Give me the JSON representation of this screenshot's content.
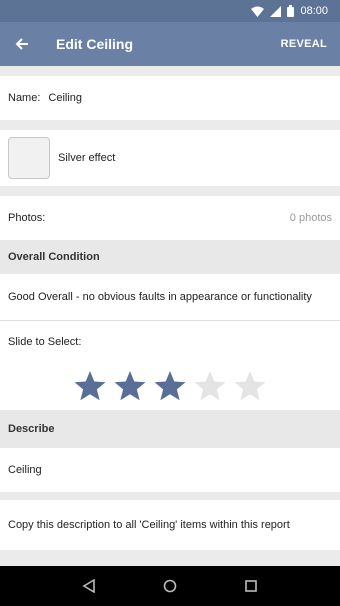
{
  "status": {
    "time": "08:00"
  },
  "appbar": {
    "title": "Edit Ceiling",
    "action": "REVEAL"
  },
  "name": {
    "label": "Name:",
    "value": "Ceiling"
  },
  "finish": {
    "label": "Silver effect"
  },
  "photos": {
    "label": "Photos:",
    "count": "0 photos"
  },
  "condition": {
    "header": "Overall Condition",
    "text": "Good Overall - no obvious faults in appearance or functionality",
    "slide_label": "Slide to Select:",
    "rating": 3,
    "max_rating": 5,
    "active_color": "#5a6f98",
    "inactive_color": "#e4e4e4"
  },
  "describe": {
    "header": "Describe",
    "value": "Ceiling",
    "copy_text": "Copy this description to all 'Ceiling' items within this report"
  },
  "colors": {
    "statusbar": "#5d7396",
    "appbar": "#6a80a5",
    "section_bg": "#e8e8e8"
  }
}
